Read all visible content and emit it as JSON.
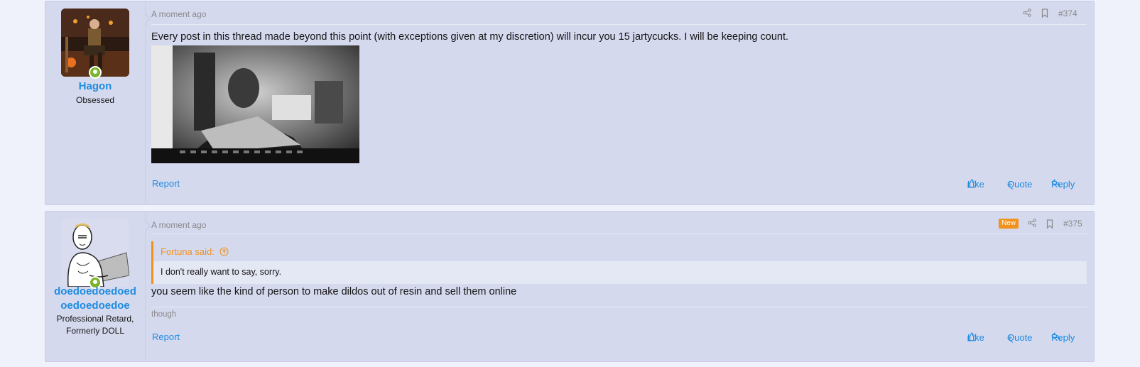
{
  "posts": [
    {
      "username": "Hagon",
      "user_title": "Obsessed",
      "date": "A moment ago",
      "number": "#374",
      "body": "Every post in this thread made beyond this point (with exceptions given at my discretion) will incur you 15 jartycucks. I will be keeping count.",
      "report_label": "Report",
      "like_label": "Like",
      "quote_label": "Quote",
      "reply_label": "Reply"
    },
    {
      "username_line1": "doedoedoedoed",
      "username_line2": "oedoedoedoe",
      "user_title_line1": "Professional Retard,",
      "user_title_line2": "Formerly DOLL",
      "date": "A moment ago",
      "new_badge": "New",
      "number": "#375",
      "quote_author": "Fortuna said:",
      "quote_text": "I don't really want to say, sorry.",
      "body": "you seem like the kind of person to make dildos out of resin and sell them online",
      "signature": "though",
      "report_label": "Report",
      "like_label": "Like",
      "quote_label": "Quote",
      "reply_label": "Reply"
    }
  ],
  "colors": {
    "accent": "#1e8ce0",
    "quote_accent": "#f0921c",
    "online": "#7bb52e",
    "post_bg": "#d5d9ee",
    "page_bg": "#eff1fb"
  }
}
